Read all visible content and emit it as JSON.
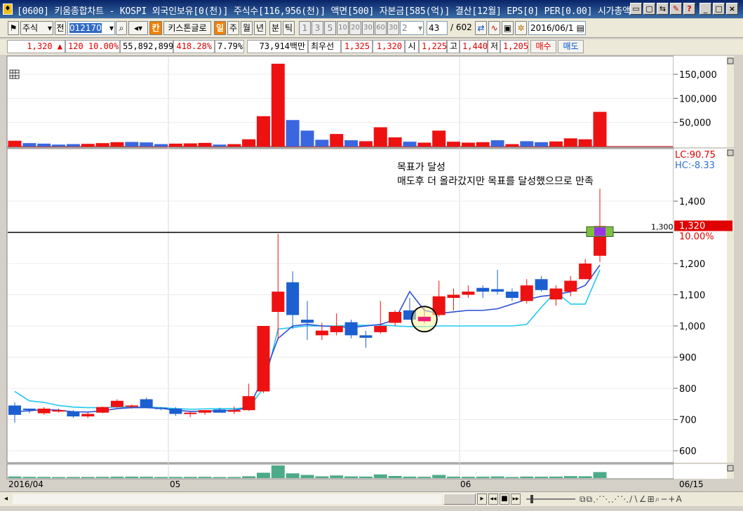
{
  "window": {
    "icon": "app-icon",
    "title": "[0600] 키움종합차트 - KOSPI 외국인보유[0(천)] 주식수[116,956(천)] 액면[500] 자본금[585(억)] 결산[12월] EPS[0] PER[0.00] 시가총액"
  },
  "toolbar": {
    "market": "주식",
    "prev_label": "전",
    "code": "012170",
    "brand_badge": "칸",
    "company": "키스톤글로",
    "period_active": "일",
    "periods": [
      "주",
      "월",
      "년",
      "분",
      "틱"
    ],
    "minute_values": [
      "1",
      "3",
      "5",
      "10",
      "20",
      "30",
      "60",
      "30"
    ],
    "minute_select": "2",
    "count_value": "43",
    "count_total": "/ 602",
    "date": "2016/06/1"
  },
  "pricebar": {
    "price": "1,320 ▲",
    "change": "120 10.00%",
    "volume": "55,892,899",
    "vol_ratio": "418.28%",
    "turnover": "7.79%",
    "amount": "73,914백만",
    "best_label": "최우선",
    "best_ask": "1,325",
    "best_bid": "1,320",
    "open_label": "시",
    "open": "1,225",
    "high_label": "고",
    "high": "1,440",
    "low_label": "저",
    "low": "1,205",
    "buy_button": "매수",
    "sell_button": "매도"
  },
  "annotation": {
    "line1": "목표가 달성",
    "line2": "매도후 더 올라갔지만 목표를 달성했으므로 만족"
  },
  "labels": {
    "lc": "LC:90.75",
    "hc": "HC:-8.33",
    "hline_value": "1,300",
    "last_price": "1,320",
    "last_pct": "10.00%"
  },
  "colors": {
    "up": "#ee1111",
    "down": "#1c5fd0",
    "ma_dark": "#2a4fd6",
    "ma_light": "#22c8f0",
    "vol_green": "#4daa88",
    "target_line": "#000000",
    "target_box_fill": "#7cc242",
    "target_box_inner": "#9b32e8"
  },
  "axes": {
    "price_ticks": [
      "1,400",
      "1,300",
      "1,200",
      "1,100",
      "1,000",
      "900",
      "800",
      "700",
      "600"
    ],
    "volume_ticks": [
      "150,000",
      "100,000",
      "50,000"
    ],
    "dates": [
      "2016/04",
      "05",
      "06",
      "06/15"
    ]
  },
  "chart_data": {
    "type": "candlestick",
    "price_axis": {
      "min": 540,
      "max": 1580
    },
    "volume_axis": {
      "min": 0,
      "max": 185000
    },
    "candles": [
      {
        "o": 745,
        "h": 755,
        "l": 690,
        "c": 715
      },
      {
        "o": 735,
        "h": 735,
        "l": 720,
        "c": 730
      },
      {
        "o": 720,
        "h": 740,
        "l": 715,
        "c": 735
      },
      {
        "o": 730,
        "h": 735,
        "l": 722,
        "c": 730
      },
      {
        "o": 725,
        "h": 730,
        "l": 705,
        "c": 710
      },
      {
        "o": 710,
        "h": 722,
        "l": 705,
        "c": 718
      },
      {
        "o": 722,
        "h": 742,
        "l": 720,
        "c": 740
      },
      {
        "o": 740,
        "h": 765,
        "l": 738,
        "c": 760
      },
      {
        "o": 742,
        "h": 748,
        "l": 735,
        "c": 745
      },
      {
        "o": 765,
        "h": 770,
        "l": 738,
        "c": 738
      },
      {
        "o": 738,
        "h": 740,
        "l": 730,
        "c": 735
      },
      {
        "o": 735,
        "h": 740,
        "l": 712,
        "c": 718
      },
      {
        "o": 718,
        "h": 725,
        "l": 708,
        "c": 722
      },
      {
        "o": 722,
        "h": 730,
        "l": 715,
        "c": 730
      },
      {
        "o": 732,
        "h": 738,
        "l": 722,
        "c": 722
      },
      {
        "o": 725,
        "h": 742,
        "l": 718,
        "c": 730
      },
      {
        "o": 730,
        "h": 815,
        "l": 728,
        "c": 775
      },
      {
        "o": 790,
        "h": 1000,
        "l": 785,
        "c": 1000
      },
      {
        "o": 1045,
        "h": 1295,
        "l": 955,
        "c": 1110
      },
      {
        "o": 1140,
        "h": 1175,
        "l": 990,
        "c": 1035
      },
      {
        "o": 1020,
        "h": 1080,
        "l": 955,
        "c": 1010
      },
      {
        "o": 970,
        "h": 1010,
        "l": 955,
        "c": 985
      },
      {
        "o": 980,
        "h": 1040,
        "l": 970,
        "c": 1000
      },
      {
        "o": 1012,
        "h": 1020,
        "l": 960,
        "c": 970
      },
      {
        "o": 970,
        "h": 985,
        "l": 930,
        "c": 962
      },
      {
        "o": 980,
        "h": 1080,
        "l": 975,
        "c": 1000
      },
      {
        "o": 1010,
        "h": 1050,
        "l": 1000,
        "c": 1045
      },
      {
        "o": 1050,
        "h": 1090,
        "l": 1020,
        "c": 1020
      },
      {
        "o": 1015,
        "h": 1060,
        "l": 1008,
        "c": 1030
      },
      {
        "o": 1035,
        "h": 1145,
        "l": 1030,
        "c": 1095
      },
      {
        "o": 1090,
        "h": 1120,
        "l": 1050,
        "c": 1100
      },
      {
        "o": 1100,
        "h": 1130,
        "l": 1090,
        "c": 1110
      },
      {
        "o": 1122,
        "h": 1130,
        "l": 1090,
        "c": 1110
      },
      {
        "o": 1118,
        "h": 1180,
        "l": 1100,
        "c": 1110
      },
      {
        "o": 1110,
        "h": 1120,
        "l": 1080,
        "c": 1090
      },
      {
        "o": 1080,
        "h": 1150,
        "l": 1072,
        "c": 1130
      },
      {
        "o": 1150,
        "h": 1160,
        "l": 1110,
        "c": 1115
      },
      {
        "o": 1085,
        "h": 1130,
        "l": 1065,
        "c": 1120
      },
      {
        "o": 1110,
        "h": 1160,
        "l": 1095,
        "c": 1145
      },
      {
        "o": 1150,
        "h": 1215,
        "l": 1150,
        "c": 1200
      },
      {
        "o": 1225,
        "h": 1440,
        "l": 1205,
        "c": 1320
      }
    ],
    "volumes": [
      12000,
      7000,
      6000,
      4000,
      5000,
      5500,
      7000,
      9000,
      9500,
      8500,
      5000,
      6000,
      6500,
      7500,
      4000,
      5000,
      15000,
      63000,
      172000,
      55000,
      33000,
      14000,
      26000,
      13000,
      11000,
      40000,
      19000,
      10000,
      8000,
      33000,
      10000,
      8000,
      9000,
      13000,
      5000,
      11000,
      9000,
      10500,
      17000,
      15000,
      72000
    ],
    "vol_direction": [
      "u",
      "d",
      "d",
      "d",
      "d",
      "u",
      "u",
      "u",
      "d",
      "d",
      "d",
      "u",
      "u",
      "u",
      "d",
      "u",
      "u",
      "u",
      "u",
      "d",
      "d",
      "d",
      "u",
      "d",
      "u",
      "u",
      "u",
      "d",
      "u",
      "u",
      "u",
      "u",
      "u",
      "d",
      "u",
      "d",
      "d",
      "u",
      "u",
      "u",
      "u"
    ],
    "ma_fast": [
      725,
      728,
      732,
      730,
      725,
      724,
      728,
      735,
      738,
      738,
      736,
      730,
      726,
      727,
      728,
      730,
      738,
      835,
      960,
      1000,
      1005,
      1000,
      998,
      995,
      1000,
      1005,
      1020,
      1110,
      1050,
      1040,
      1045,
      1050,
      1050,
      1055,
      1070,
      1085,
      1095,
      1100,
      1110,
      1130,
      1195
    ],
    "ma_slow": [
      790,
      760,
      755,
      745,
      740,
      738,
      738,
      740,
      740,
      740,
      738,
      735,
      733,
      734,
      735,
      735,
      738,
      800,
      990,
      995,
      1000,
      1000,
      1000,
      1002,
      1002,
      1003,
      1000,
      998,
      998,
      1000,
      1000,
      1000,
      1000,
      1000,
      1000,
      1005,
      1060,
      1110,
      1070,
      1070,
      1180
    ],
    "target_price": 1300,
    "last_close": 1320,
    "ref_tick": {
      "value": 1300
    },
    "title": "",
    "xlabel": "",
    "ylabel": ""
  }
}
